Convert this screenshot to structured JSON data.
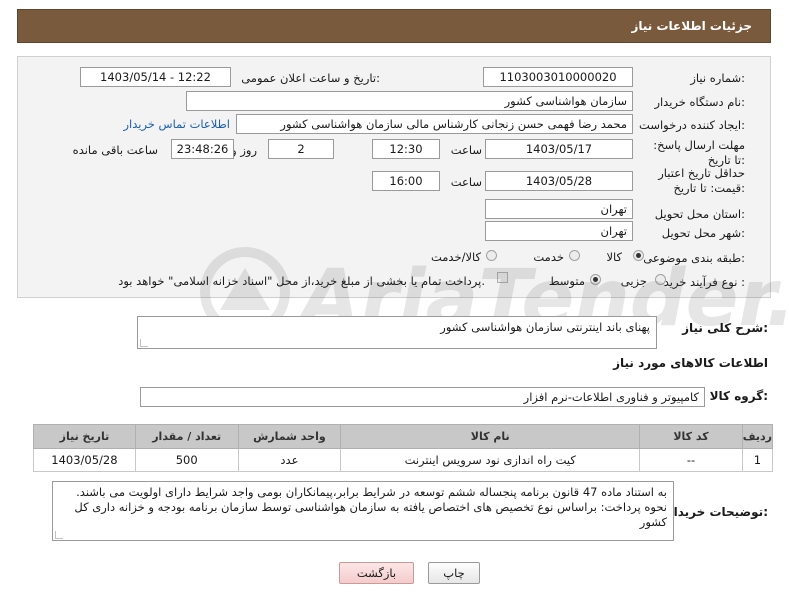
{
  "header": {
    "title": "جزئیات اطلاعات نیاز"
  },
  "form": {
    "need_number_label": "شماره نیاز:",
    "need_number": "1103003010000020",
    "announce_label": "تاریخ و ساعت اعلان عمومی:",
    "announce_value": "1403/05/14 - 12:22",
    "buyer_org_label": "نام دستگاه خریدار:",
    "buyer_org": "سازمان هواشناسی کشور",
    "requester_label": "ایجاد کننده درخواست:",
    "requester": "محمد رضا فهمی حسن زنجانی کارشناس مالی سازمان هواشناسی کشور",
    "contact_link": "اطلاعات تماس خریدار",
    "deadline_label": "مهلت ارسال پاسخ: تا تاریخ:",
    "deadline_date": "1403/05/17",
    "time_label": "ساعت",
    "deadline_time": "12:30",
    "days_value": "2",
    "days_label": "روز و",
    "remaining_time": "23:48:26",
    "remaining_label": "ساعت باقی مانده",
    "validity_label": "حداقل تاریخ اعتبار قیمت: تا تاریخ:",
    "validity_date": "1403/05/28",
    "validity_time": "16:00",
    "province_label": "استان محل تحویل:",
    "province": "تهران",
    "city_label": "شهر محل تحویل:",
    "city": "تهران",
    "category_label": "طبقه بندی موضوعی:",
    "category_options": [
      "کالا",
      "خدمت",
      "کالا/خدمت"
    ],
    "process_label": "نوع فرآیند خرید :",
    "process_options": [
      "جزیی",
      "متوسط"
    ],
    "payment_note": "پرداخت تمام یا بخشی از مبلغ خرید،از محل \"اسناد خزانه اسلامی\" خواهد بود."
  },
  "description": {
    "label": "شرح کلی نیاز:",
    "value": "پهنای باند اینترنتی سازمان هواشناسی کشور"
  },
  "goods_section": {
    "title": "اطلاعات کالاهای مورد نیاز",
    "group_label": "گروه کالا:",
    "group_value": "کامپیوتر و فناوری اطلاعات-نرم افزار",
    "columns": [
      "ردیف",
      "کد کالا",
      "نام کالا",
      "واحد شمارش",
      "تعداد / مقدار",
      "تاریخ نیاز"
    ],
    "rows": [
      {
        "index": "1",
        "code": "--",
        "name": "کیت راه اندازی نود سرویس اینترنت",
        "unit": "عدد",
        "qty": "500",
        "date": "1403/05/28"
      }
    ]
  },
  "buyer_notes": {
    "label": "توضیحات خریدار:",
    "value": "به استناد ماده 47 قانون برنامه پنجساله ششم توسعه در شرایط برابر،پیمانکاران بومی واجد شرایط دارای اولویت می باشند. نحوه پرداخت: براساس نوع تخصیص های اختصاص یافته به سازمان هواشناسی توسط سازمان برنامه بودجه و خزانه داری کل کشور"
  },
  "buttons": {
    "back": "بازگشت",
    "print": "چاپ"
  },
  "watermark": {
    "text": "AriaTender.neT"
  },
  "colors": {
    "header_bg": "#7a5a3c",
    "panel_bg": "#f3f3f3",
    "table_header": "#c8c8c8",
    "link": "#1a5fb4"
  }
}
